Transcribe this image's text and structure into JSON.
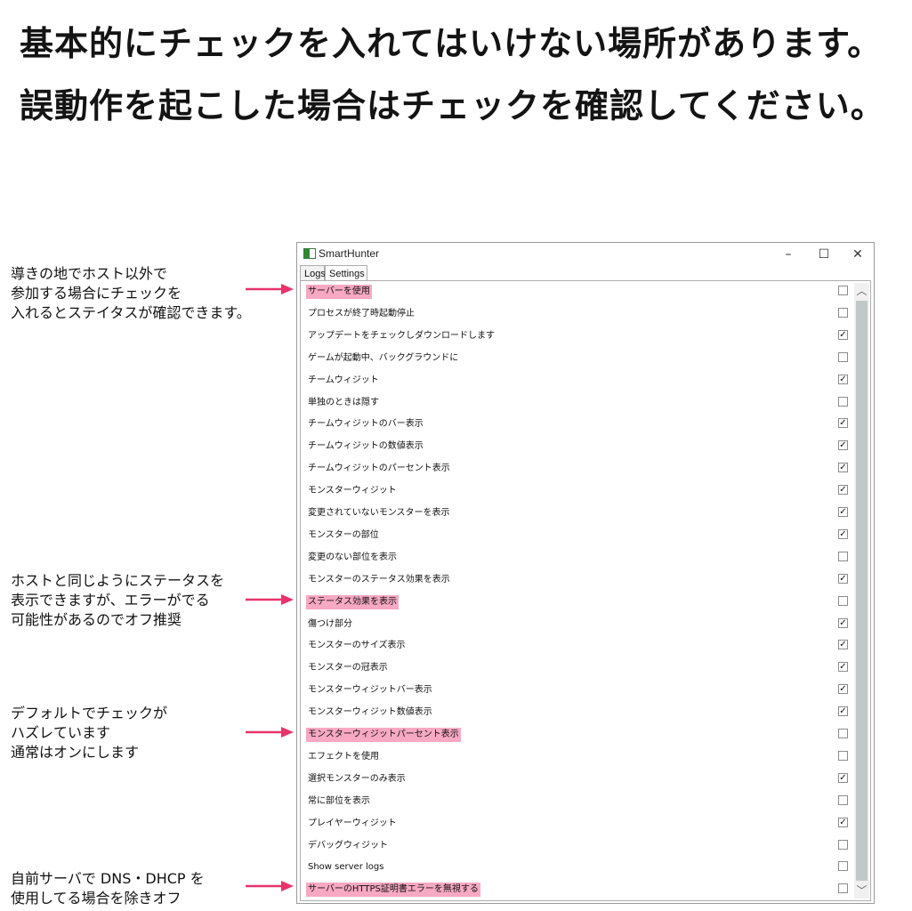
{
  "headlines": [
    "基本的にチェックを入れてはいけない場所があります。",
    "誤動作を起こした場合はチェックを確認してください。"
  ],
  "annotations": {
    "first": [
      "導きの地でホスト以外で",
      "参加する場合にチェックを",
      "入れるとステイタスが確認できます。"
    ],
    "second": [
      "ホストと同じようにステータスを",
      "表示できますが、エラーがでる",
      "可能性があるのでオフ推奨"
    ],
    "third": [
      "デフォルトでチェックが",
      "ハズレています",
      "通常はオンにします"
    ],
    "fourth": [
      "自前サーバで DNS・DHCP を",
      "使用してる場合を除きオフ"
    ]
  },
  "window": {
    "title": "SmartHunter",
    "controls": {
      "minimize": "–",
      "maximize": "☐",
      "close": "✕"
    },
    "tabs": [
      "Logs",
      "Settings"
    ],
    "selected_tab": "Settings"
  },
  "settings": [
    {
      "label": "サーバーを使用",
      "checked": false,
      "highlighted": true
    },
    {
      "label": "プロセスが終了時起動停止",
      "checked": false,
      "highlighted": false
    },
    {
      "label": "アップデートをチェックしダウンロードします",
      "checked": true,
      "highlighted": false
    },
    {
      "label": "ゲームが起動中、バックグラウンドに",
      "checked": false,
      "highlighted": false
    },
    {
      "label": "チームウィジット",
      "checked": true,
      "highlighted": false
    },
    {
      "label": "単独のときは隠す",
      "checked": false,
      "highlighted": false
    },
    {
      "label": "チームウィジットのバー表示",
      "checked": true,
      "highlighted": false
    },
    {
      "label": "チームウィジットの数値表示",
      "checked": true,
      "highlighted": false
    },
    {
      "label": "チームウィジットのパーセント表示",
      "checked": true,
      "highlighted": false
    },
    {
      "label": "モンスターウィジット",
      "checked": true,
      "highlighted": false
    },
    {
      "label": "変更されていないモンスターを表示",
      "checked": true,
      "highlighted": false
    },
    {
      "label": "モンスターの部位",
      "checked": true,
      "highlighted": false
    },
    {
      "label": "変更のない部位を表示",
      "checked": false,
      "highlighted": false
    },
    {
      "label": "モンスターのステータス効果を表示",
      "checked": true,
      "highlighted": false
    },
    {
      "label": "ステータス効果を表示",
      "checked": false,
      "highlighted": true
    },
    {
      "label": "傷つけ部分",
      "checked": true,
      "highlighted": false
    },
    {
      "label": "モンスターのサイズ表示",
      "checked": true,
      "highlighted": false
    },
    {
      "label": "モンスターの冠表示",
      "checked": true,
      "highlighted": false
    },
    {
      "label": "モンスターウィジットバー表示",
      "checked": true,
      "highlighted": false
    },
    {
      "label": "モンスターウィジット数値表示",
      "checked": true,
      "highlighted": false
    },
    {
      "label": "モンスターウィジットパーセント表示",
      "checked": false,
      "highlighted": true
    },
    {
      "label": "エフェクトを使用",
      "checked": false,
      "highlighted": false
    },
    {
      "label": "選択モンスターのみ表示",
      "checked": true,
      "highlighted": false
    },
    {
      "label": "常に部位を表示",
      "checked": false,
      "highlighted": false
    },
    {
      "label": "プレイヤーウィジット",
      "checked": true,
      "highlighted": false
    },
    {
      "label": "デバッグウィジット",
      "checked": false,
      "highlighted": false
    },
    {
      "label": "Show server logs",
      "checked": false,
      "highlighted": false
    },
    {
      "label": "サーバーのHTTPS証明書エラーを無視する",
      "checked": false,
      "highlighted": true
    }
  ],
  "scrollbar": {
    "up": "︿",
    "down": "﹀"
  },
  "colors": {
    "highlight": "#f7a8c3",
    "arrow": "#e8336b"
  }
}
